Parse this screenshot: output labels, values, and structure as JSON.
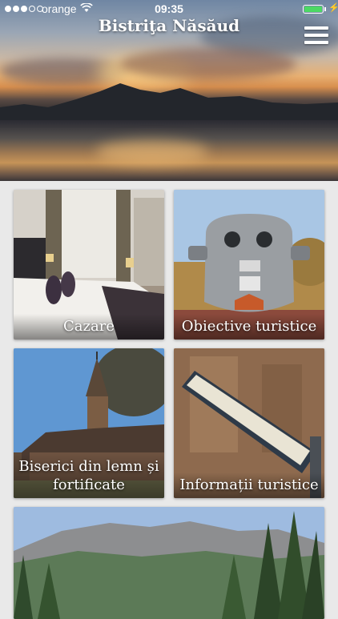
{
  "status_bar": {
    "carrier": "orange",
    "time": "09:35",
    "battery_level": 1.0,
    "icons": [
      "signal-dots-icon",
      "wifi-icon",
      "battery-icon",
      "charging-bolt-icon"
    ]
  },
  "header": {
    "title": "Bistriţa Năsăud",
    "menu_icon": "hamburger-menu-icon"
  },
  "tiles": [
    {
      "label": "Cazare"
    },
    {
      "label": "Obiective turistice"
    },
    {
      "label": "Biserici din lemn și fortificate"
    },
    {
      "label": "Informații turistice"
    },
    {
      "label": ""
    }
  ],
  "colors": {
    "battery_fill": "#4cd964",
    "background": "#e9e9e9",
    "label_text": "#ffffff"
  }
}
